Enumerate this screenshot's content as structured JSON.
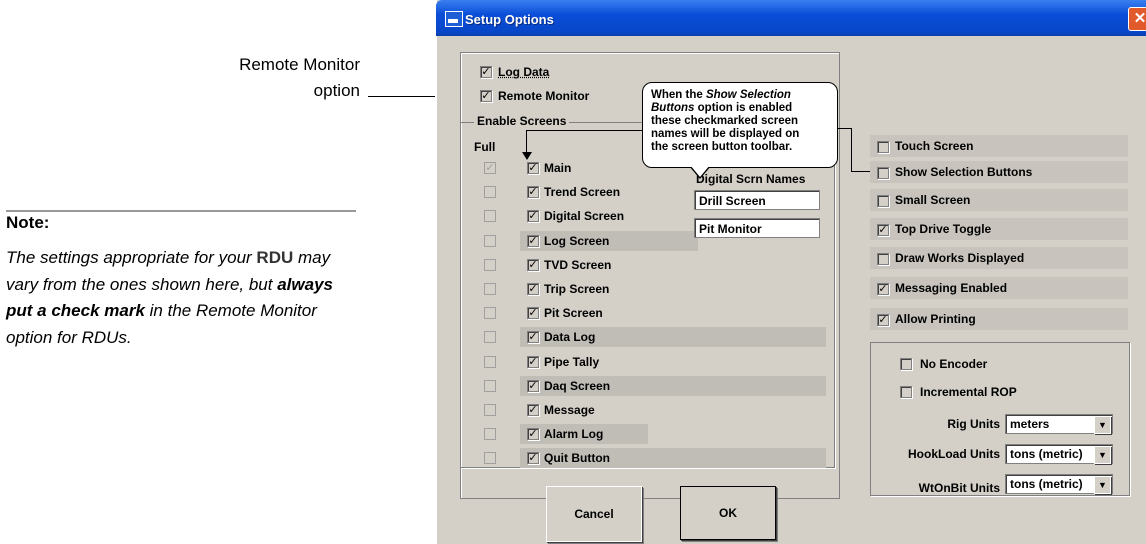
{
  "annotation": {
    "callout_line1": "Remote Monitor",
    "callout_line2": "option",
    "note_heading": "Note:",
    "note_p1": "The settings appropriate for your",
    "note_rdu": "RDU",
    "note_p2": "may vary from the ones shown here, but",
    "note_strong": "always put a check mark",
    "note_p3": "in the Remote Monitor option for RDUs."
  },
  "window": {
    "title": "Setup Options",
    "close_glyph": "✕"
  },
  "top_options": [
    {
      "label": "Log Data",
      "checked": true
    },
    {
      "label": "Remote Monitor",
      "checked": true
    }
  ],
  "enable_screens": {
    "legend": "Enable Screens",
    "full_label": "Full",
    "rows": [
      {
        "label": "Main",
        "full": true,
        "checked": true
      },
      {
        "label": "Trend Screen",
        "full": false,
        "checked": true
      },
      {
        "label": "Digital Screen",
        "full": false,
        "checked": true
      },
      {
        "label": "Log Screen",
        "full": false,
        "checked": true
      },
      {
        "label": "TVD Screen",
        "full": false,
        "checked": true
      },
      {
        "label": "Trip Screen",
        "full": false,
        "checked": true
      },
      {
        "label": "Pit Screen",
        "full": false,
        "checked": true
      },
      {
        "label": "Data Log",
        "full": false,
        "checked": true
      },
      {
        "label": "Pipe Tally",
        "full": false,
        "checked": true
      },
      {
        "label": "Daq Screen",
        "full": false,
        "checked": true
      },
      {
        "label": "Message",
        "full": false,
        "checked": true
      },
      {
        "label": "Alarm Log",
        "full": false,
        "checked": true
      },
      {
        "label": "Quit Button",
        "full": false,
        "checked": true
      }
    ]
  },
  "digital_names": {
    "title": "Digital Scrn Names",
    "field1": "Drill Screen",
    "field2": "Pit Monitor"
  },
  "tooltip": {
    "line1": "When the",
    "line1_em": "Show Selection",
    "line2_em": "Buttons",
    "line2": "option is enabled",
    "line3": "these checkmarked screen",
    "line4": "names will be displayed on",
    "line5": "the screen button toolbar."
  },
  "right_options": [
    {
      "label": "Touch Screen",
      "checked": false
    },
    {
      "label": "Show Selection Buttons",
      "checked": false
    },
    {
      "label": "Small Screen",
      "checked": false
    },
    {
      "label": "Top Drive Toggle",
      "checked": true
    },
    {
      "label": "Draw Works Displayed",
      "checked": false
    },
    {
      "label": "Messaging Enabled",
      "checked": true
    },
    {
      "label": "Allow Printing",
      "checked": true
    }
  ],
  "units": {
    "no_encoder": "No Encoder",
    "incremental_rop": "Incremental ROP",
    "rig_units_label": "Rig Units",
    "rig_units_value": "meters",
    "hookload_label": "HookLoad Units",
    "hookload_value": "tons (metric)",
    "wtonbit_label": "WtOnBit Units",
    "wtonbit_value": "tons (metric)"
  },
  "buttons": {
    "cancel": "Cancel",
    "ok": "OK"
  },
  "check_glyph": "✓",
  "dropdown_glyph": "▼"
}
